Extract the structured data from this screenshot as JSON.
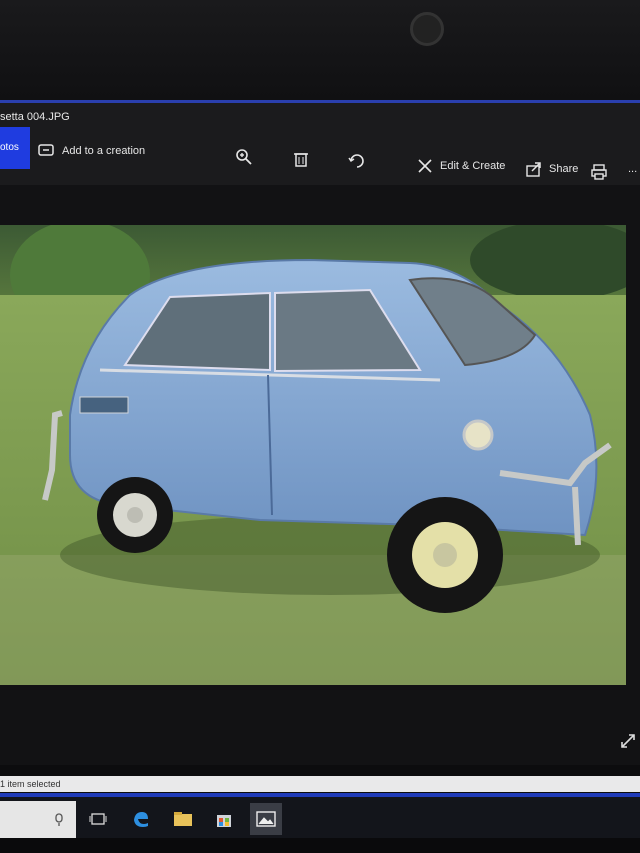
{
  "window": {
    "title": "setta 004.JPG",
    "controls": {
      "minimize": "–",
      "maximize": "☐",
      "close": "✕"
    }
  },
  "toolbar": {
    "photos_label": "otos",
    "add_to_creation": "Add to a creation",
    "edit_create": "Edit & Create",
    "share": "Share",
    "more": "..."
  },
  "status": {
    "text": "1 item selected"
  },
  "icons": {
    "zoom": "zoom-in-icon",
    "delete": "trash-icon",
    "rotate": "rotate-icon",
    "edit": "edit-create-icon",
    "share": "share-icon",
    "print": "print-icon",
    "fullscreen": "expand-icon"
  },
  "colors": {
    "accent": "#1f3ce0",
    "car_body": "#84a6cf",
    "grass": "#7f9d4f",
    "background": "#1b1b1d"
  }
}
